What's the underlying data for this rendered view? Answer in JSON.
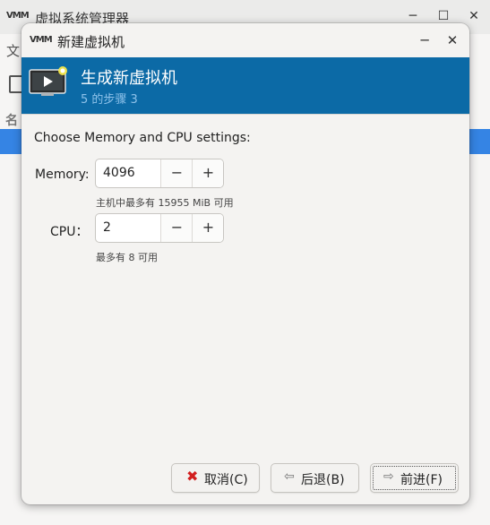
{
  "main_window": {
    "title": "虚拟系统管理器",
    "logo_text": "VMM",
    "menu_first": "文",
    "column_header": "名",
    "window_controls": {
      "minimize": "─",
      "maximize": "☐",
      "close": "✕"
    }
  },
  "dialog": {
    "title": "新建虚拟机",
    "logo_text": "VMM",
    "controls": {
      "minimize": "─",
      "close": "✕"
    },
    "banner": {
      "title": "生成新虚拟机",
      "step": "5 的步骤 3",
      "icon": "vm-monitor-icon"
    },
    "instruction": "Choose Memory and CPU settings:",
    "memory": {
      "label": "Memory:",
      "value": "4096",
      "hint": "主机中最多有 15955 MiB 可用"
    },
    "cpu": {
      "label": "CPU：",
      "value": "2",
      "hint": "最多有 8 可用"
    },
    "spin_glyphs": {
      "minus": "−",
      "plus": "+"
    },
    "buttons": {
      "cancel": {
        "label": "取消(C)",
        "icon": "cancel-x-icon"
      },
      "back": {
        "label": "后退(B)",
        "icon": "back-arrow-icon"
      },
      "forward": {
        "label": "前进(F)",
        "icon": "forward-arrow-icon"
      }
    }
  },
  "colors": {
    "banner": "#0c6aa6",
    "banner_sub": "#8ec2ea",
    "selection": "#3584e4",
    "cancel_icon": "#d21f1f"
  }
}
